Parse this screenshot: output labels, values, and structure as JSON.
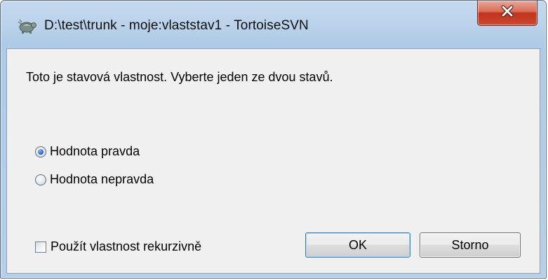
{
  "window": {
    "title": "D:\\test\\trunk - moje:vlaststav1 - TortoiseSVN",
    "app_icon": "tortoise-icon",
    "close_icon": "close-icon"
  },
  "dialog": {
    "description": "Toto je stavová vlastnost. Vyberte jeden ze dvou stavů.",
    "options": [
      {
        "label": "Hodnota pravda",
        "selected": true
      },
      {
        "label": "Hodnota nepravda",
        "selected": false
      }
    ],
    "recursive": {
      "label": "Použít vlastnost rekurzivně",
      "checked": false
    },
    "ok_label": "OK",
    "cancel_label": "Storno"
  },
  "colors": {
    "titlebar": "#b9d1ea",
    "close_button": "#c94a32",
    "client_background": "#f0f0f0",
    "default_button_border": "#3c7fb1"
  }
}
